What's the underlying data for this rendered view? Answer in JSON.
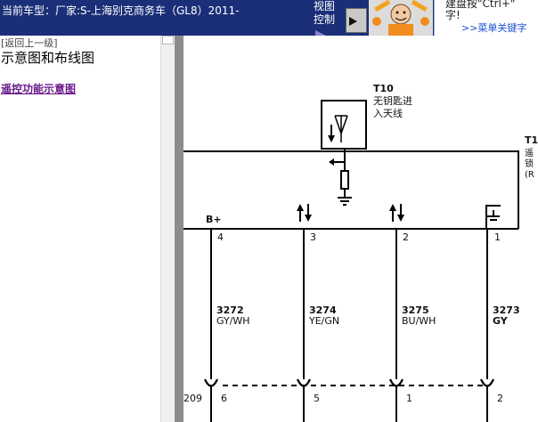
{
  "header": {
    "title": "当前车型：厂家:S-上海别克商务车（GL8）2011-",
    "view_control": [
      "视图",
      "控制"
    ],
    "info_line1": "建盘按\"Ctrl+\"",
    "info_line2": "字!",
    "menu_link": ">>菜单关键字"
  },
  "left_pane": {
    "back_link": "[返回上一级]",
    "section_title": "示意图和布线图",
    "diagram_link": "遥控功能示意图"
  },
  "diagram": {
    "component": {
      "id": "T10",
      "name_line1": "无钥匙进",
      "name_line2": "入天线"
    },
    "right_component": {
      "id": "T1",
      "line1": "遥",
      "line2": "锁",
      "line3": "(R"
    },
    "power_label": "B+",
    "pins": [
      {
        "pin": "4",
        "circuit": "3272",
        "color": "GY/WH",
        "connector_pin": "6"
      },
      {
        "pin": "3",
        "circuit": "3274",
        "color": "YE/GN",
        "connector_pin": "5"
      },
      {
        "pin": "2",
        "circuit": "3275",
        "color": "BU/WH",
        "connector_pin": "1"
      },
      {
        "pin": "1",
        "circuit": "3273",
        "color": "GY",
        "connector_pin": "2"
      }
    ],
    "connector_id": "209"
  }
}
